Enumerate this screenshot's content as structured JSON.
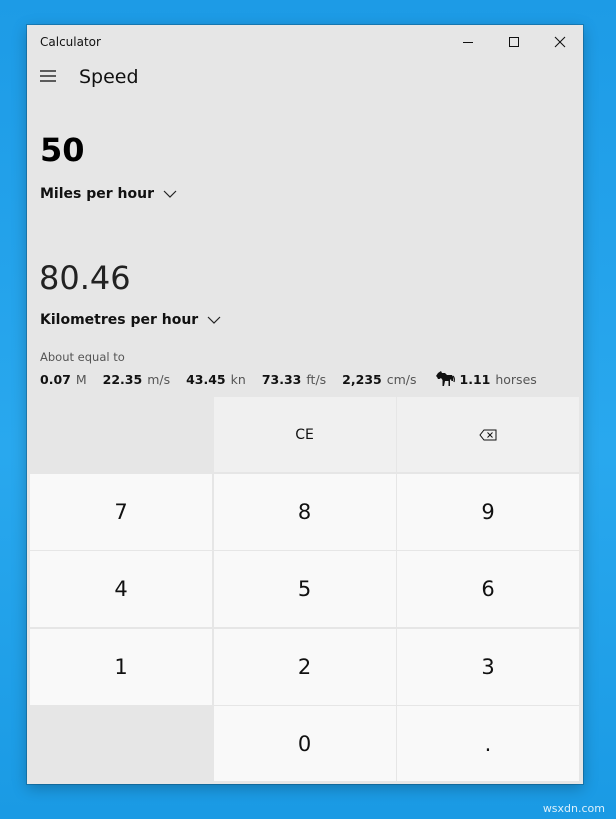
{
  "window": {
    "title": "Calculator",
    "mode": "Speed"
  },
  "converter": {
    "from_value": "50",
    "from_unit": "Miles per hour",
    "to_value": "80.46",
    "to_unit": "Kilometres per hour",
    "about_label": "About equal to",
    "equivalents": [
      {
        "value": "0.07",
        "unit": "M"
      },
      {
        "value": "22.35",
        "unit": "m/s"
      },
      {
        "value": "43.45",
        "unit": "kn"
      },
      {
        "value": "73.33",
        "unit": "ft/s"
      },
      {
        "value": "2,235",
        "unit": "cm/s"
      },
      {
        "value": "1.11",
        "unit": "horses",
        "icon": "horse-icon"
      }
    ]
  },
  "keypad": {
    "ce": "CE",
    "backspace_icon": "backspace-icon",
    "k7": "7",
    "k8": "8",
    "k9": "9",
    "k4": "4",
    "k5": "5",
    "k6": "6",
    "k1": "1",
    "k2": "2",
    "k3": "3",
    "k0": "0",
    "decimal": "."
  },
  "watermark": "wsxdn.com",
  "colors": {
    "desktop": "#1d9be6",
    "window_bg": "#e6e6e6",
    "key_bg": "#f9f9f9",
    "op_key_bg": "#f0f0f0"
  }
}
